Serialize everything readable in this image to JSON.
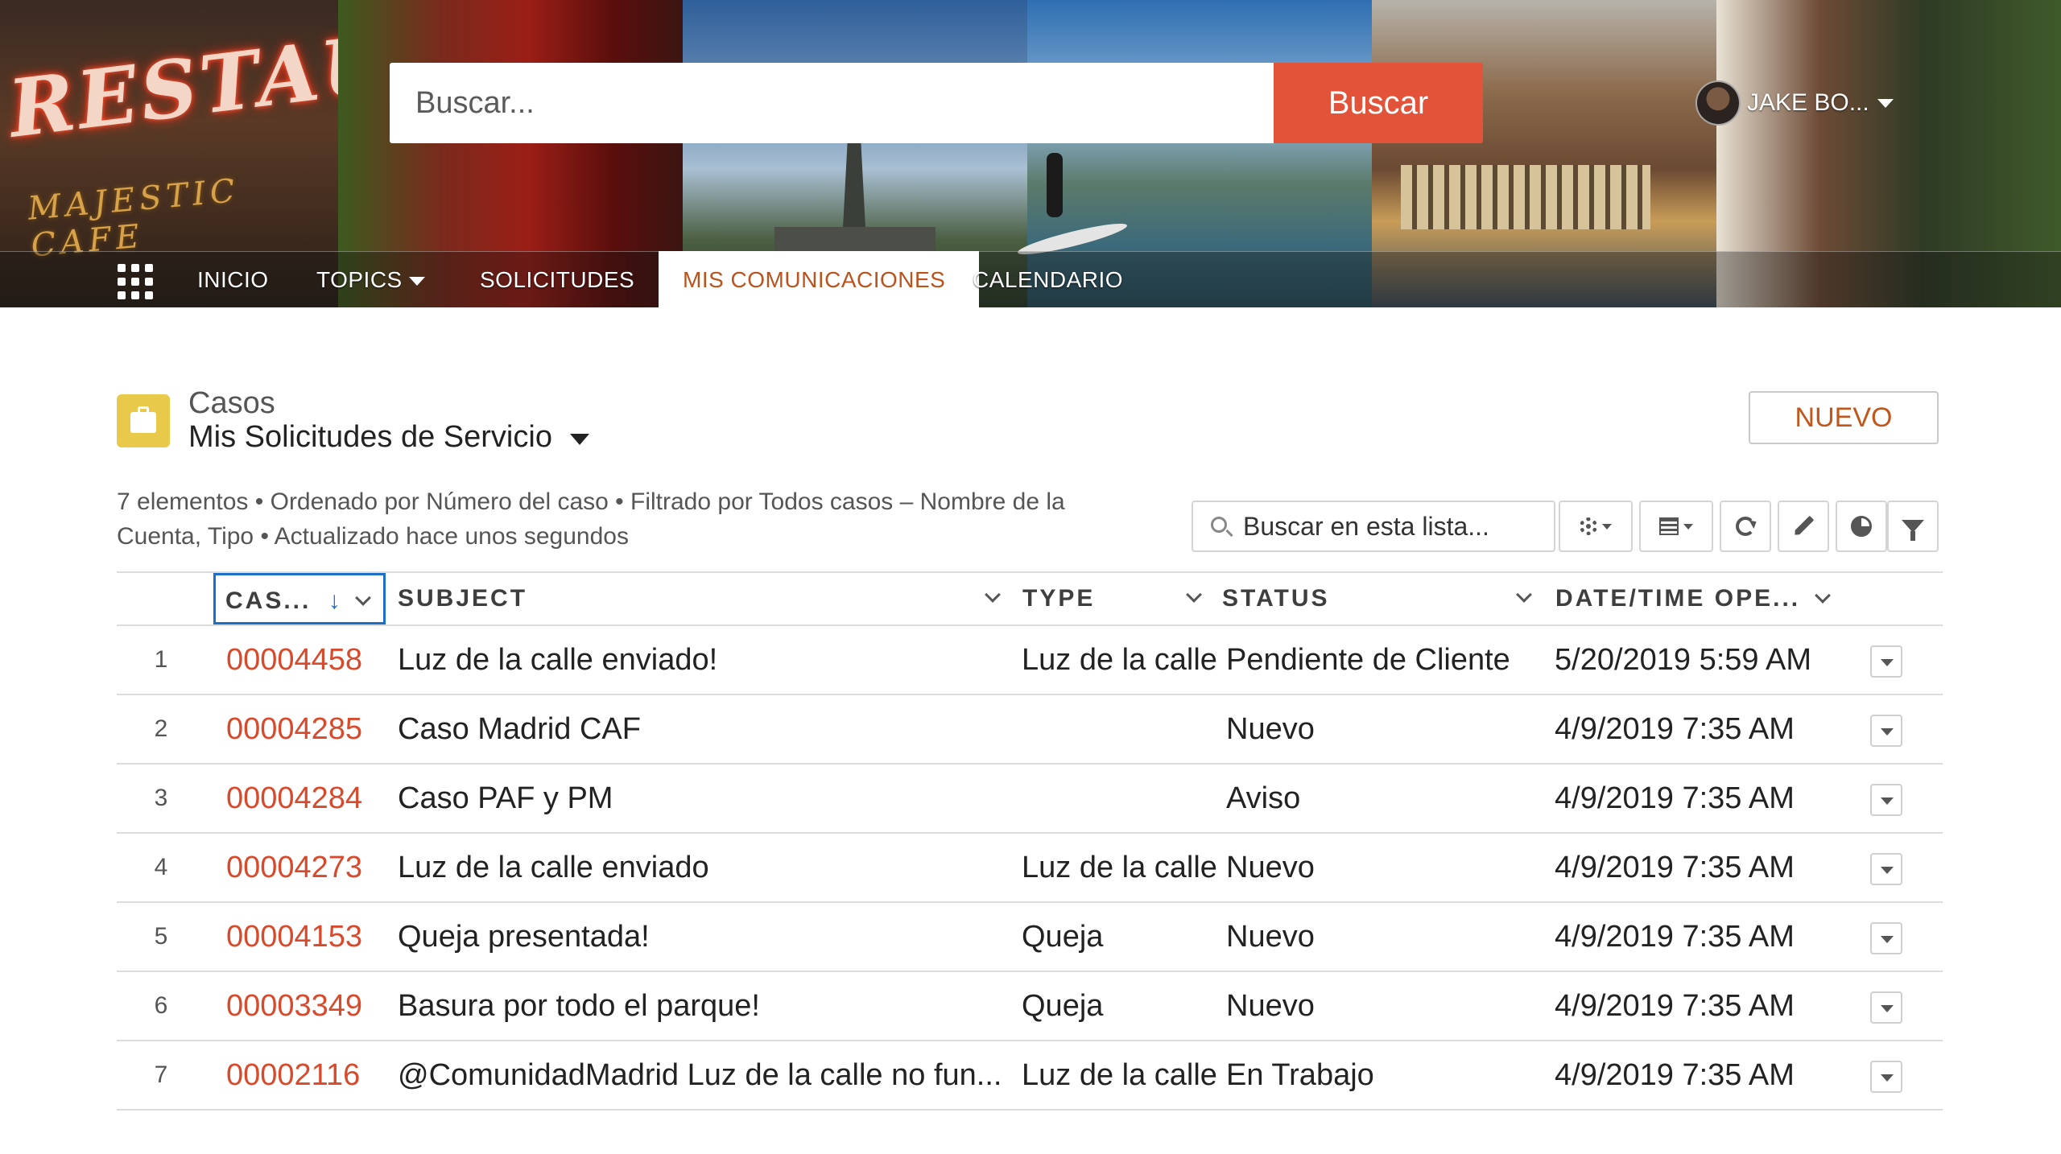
{
  "header": {
    "search_placeholder": "Buscar...",
    "search_button": "Buscar",
    "user_name": "JAKE BO...",
    "banner_neon": "RESTAU",
    "banner_cafe": "MAJESTIC CAFE"
  },
  "nav": {
    "items": [
      {
        "label": "INICIO"
      },
      {
        "label": "TOPICS"
      },
      {
        "label": "SOLICITUDES"
      },
      {
        "label": "MIS COMUNICACIONES"
      },
      {
        "label": "CALENDARIO"
      }
    ],
    "active": "MIS COMUNICACIONES"
  },
  "list": {
    "object_label": "Casos",
    "title": "Mis Solicitudes de Servicio",
    "new_button": "NUEVO",
    "meta": "7 elementos • Ordenado por Número del caso • Filtrado por Todos casos – Nombre de la Cuenta, Tipo • Actualizado hace unos segundos",
    "search_placeholder": "Buscar en esta lista...",
    "sort_arrow": "↓",
    "columns": {
      "case": "CAS...",
      "subject": "SUBJECT",
      "type": "TYPE",
      "status": "STATUS",
      "date": "DATE/TIME OPE..."
    },
    "rows": [
      {
        "num": "1",
        "case": "00004458",
        "subject": "Luz de la calle enviado!",
        "type": "Luz de la calle",
        "status": "Pendiente de Cliente",
        "date": "5/20/2019 5:59 AM"
      },
      {
        "num": "2",
        "case": "00004285",
        "subject": "Caso Madrid CAF",
        "type": "",
        "status": "Nuevo",
        "date": "4/9/2019 7:35 AM"
      },
      {
        "num": "3",
        "case": "00004284",
        "subject": "Caso PAF y PM",
        "type": "",
        "status": "Aviso",
        "date": "4/9/2019 7:35 AM"
      },
      {
        "num": "4",
        "case": "00004273",
        "subject": "Luz de la calle enviado",
        "type": "Luz de la calle",
        "status": "Nuevo",
        "date": "4/9/2019 7:35 AM"
      },
      {
        "num": "5",
        "case": "00004153",
        "subject": "Queja presentada!",
        "type": "Queja",
        "status": "Nuevo",
        "date": "4/9/2019 7:35 AM"
      },
      {
        "num": "6",
        "case": "00003349",
        "subject": "Basura por todo el parque!",
        "type": "Queja",
        "status": "Nuevo",
        "date": "4/9/2019 7:35 AM"
      },
      {
        "num": "7",
        "case": "00002116",
        "subject": "@ComunidadMadrid Luz de la calle no fun...",
        "type": "Luz de la calle",
        "status": "En Trabajo",
        "date": "4/9/2019 7:35 AM"
      }
    ]
  },
  "colors": {
    "accent": "#e2533a",
    "case_link": "#d84a2c",
    "active_tab_text": "#b9541f",
    "object_icon": "#e8c94a",
    "sort_highlight": "#1b6fc9"
  },
  "icons": [
    "app-launcher-icon",
    "caret-down-icon",
    "briefcase-icon",
    "search-icon",
    "gear-icon",
    "table-icon",
    "refresh-icon",
    "pencil-icon",
    "chart-icon",
    "filter-icon",
    "sort-down-icon",
    "chevron-down-icon"
  ]
}
